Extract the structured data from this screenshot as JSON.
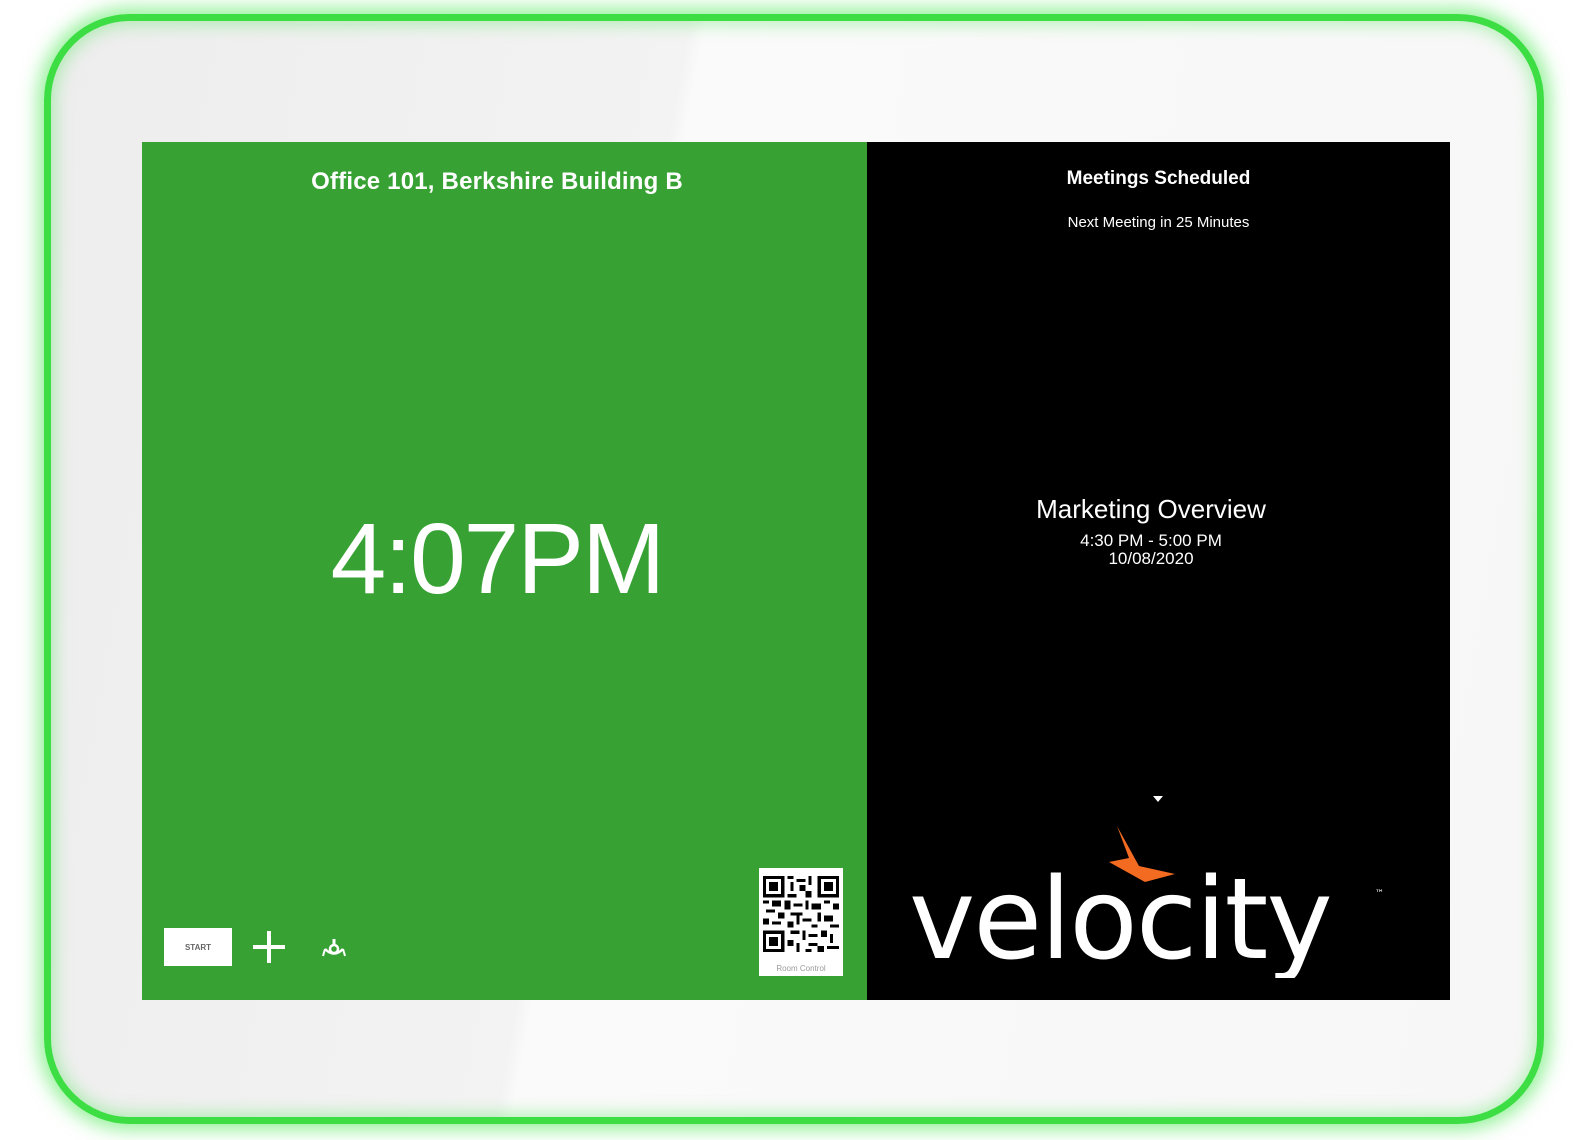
{
  "room": {
    "name": "Office 101, Berkshire Building B",
    "status_color": "#37a233"
  },
  "clock": {
    "time": "4:07PM"
  },
  "actions": {
    "start_label": "START",
    "add_icon": "plus-icon",
    "room_control_icon": "room-control-icon"
  },
  "qr": {
    "caption": "Room Control"
  },
  "schedule": {
    "header": "Meetings Scheduled",
    "next_meeting": "Next Meeting in 25 Minutes",
    "meeting": {
      "title": "Marketing Overview",
      "time": "4:30 PM - 5:00 PM",
      "date": "10/08/2020"
    }
  },
  "brand": {
    "logo_text": "velocity",
    "accent_color": "#f26b21",
    "bezel_glow_color": "#3dde44"
  }
}
